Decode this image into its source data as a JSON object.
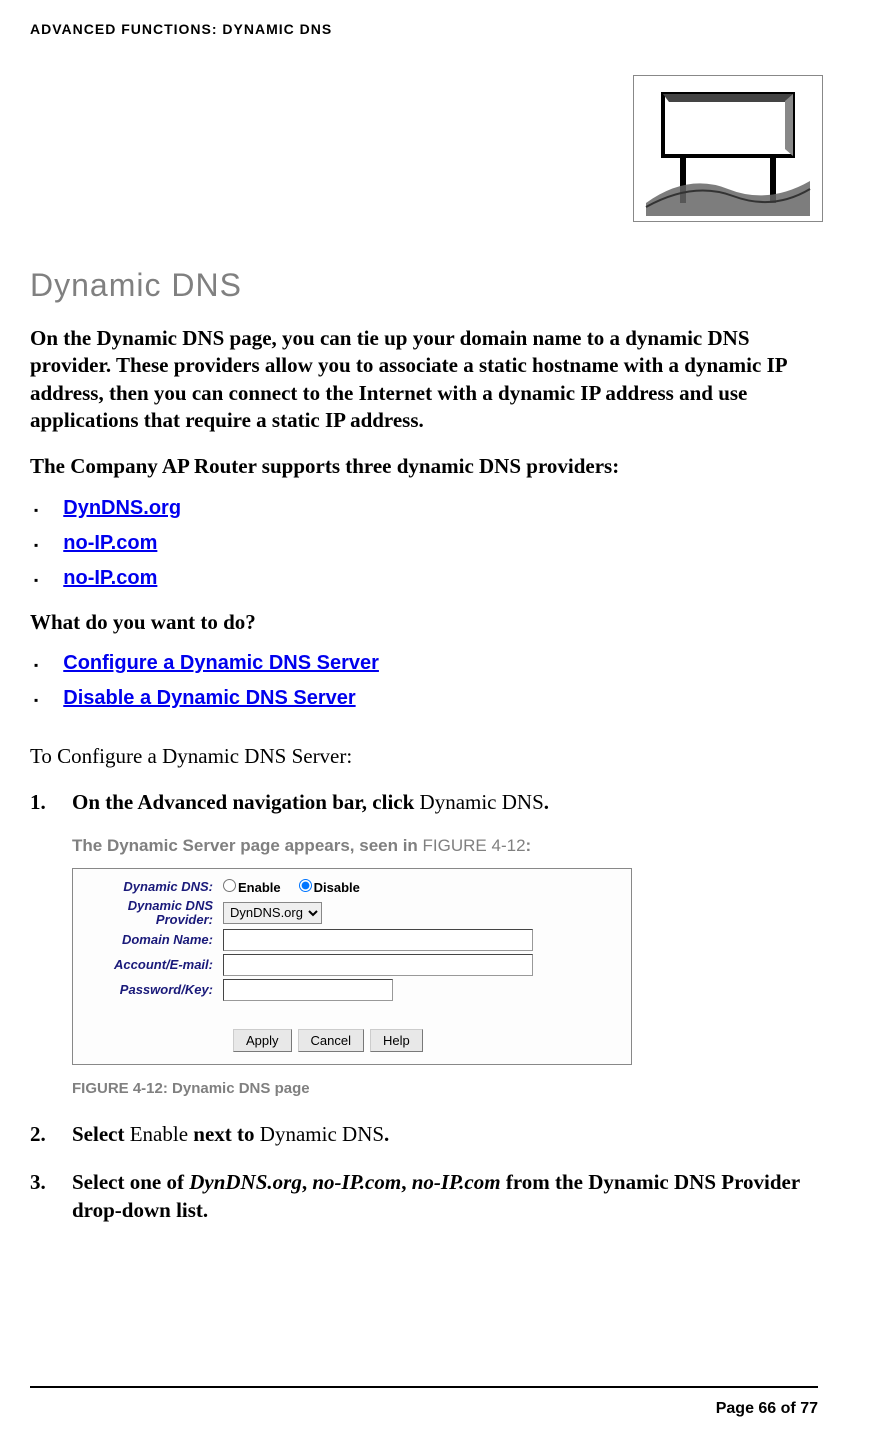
{
  "header": {
    "breadcrumb": "ADVANCED FUNCTIONS: DYNAMIC DNS"
  },
  "section": {
    "title": "Dynamic DNS",
    "intro": "On the Dynamic DNS page, you can tie up your domain name to a dynamic DNS provider. These providers allow you to associate a static hostname with a dynamic IP address, then you can connect to the Internet with a dynamic IP address and use applications that require a static IP address.",
    "supports": "The Company AP Router supports three dynamic DNS providers:",
    "providers": [
      "DynDNS.org",
      "no-IP.com",
      "no-IP.com"
    ],
    "question": "What do you want to do?",
    "actions": [
      "Configure a Dynamic DNS Server",
      "Disable a Dynamic DNS Server"
    ],
    "configure_heading": "To Configure a Dynamic DNS Server:"
  },
  "steps": {
    "s1": {
      "num": "1.",
      "prefix": "On the Advanced navigation bar, click ",
      "target": "Dynamic DNS",
      "suffix": "."
    },
    "result_prefix": "The Dynamic Server page appears, seen in ",
    "result_figref": "FIGURE 4-12",
    "result_suffix": ":",
    "fig_caption_ref": "FIGURE 4-12: ",
    "fig_caption_title": "Dynamic DNS page",
    "s2": {
      "num": "2.",
      "a": "Select ",
      "b": "Enable",
      "c": " next to ",
      "d": "Dynamic DNS",
      "e": "."
    },
    "s3": {
      "num": "3.",
      "a": "Select one of ",
      "b": "DynDNS.org",
      "c": ", ",
      "d": "no-IP.com",
      "e": ", ",
      "f": "no-IP.com",
      "g": " from the Dynamic DNS Provider drop-down list."
    }
  },
  "figure": {
    "labels": {
      "ddns": "Dynamic DNS:",
      "provider_l1": "Dynamic DNS",
      "provider_l2": "Provider:",
      "domain": "Domain Name:",
      "account": "Account/E-mail:",
      "password": "Password/Key:"
    },
    "radios": {
      "enable": "Enable",
      "disable": "Disable"
    },
    "select_value": "DynDNS.org",
    "buttons": {
      "apply": "Apply",
      "cancel": "Cancel",
      "help": "Help"
    }
  },
  "footer": {
    "pager": "Page 66 of 77"
  }
}
